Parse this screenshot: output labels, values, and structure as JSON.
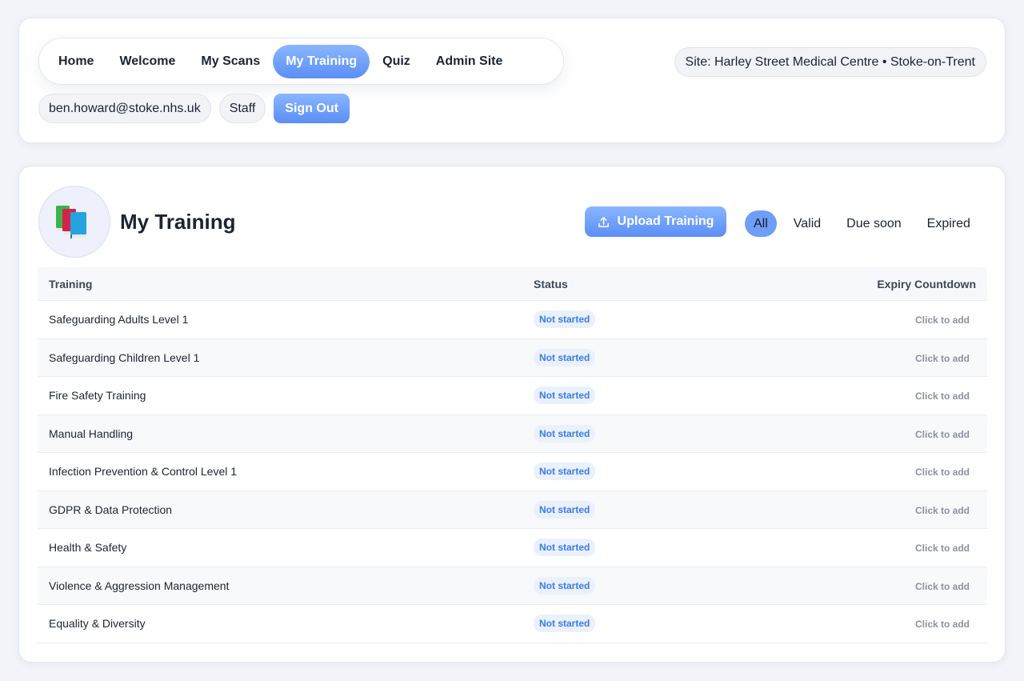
{
  "nav": {
    "items": [
      {
        "label": "Home",
        "active": false
      },
      {
        "label": "Welcome",
        "active": false
      },
      {
        "label": "My Scans",
        "active": false
      },
      {
        "label": "My Training",
        "active": true
      },
      {
        "label": "Quiz",
        "active": false
      },
      {
        "label": "Admin Site",
        "active": false
      }
    ]
  },
  "site": {
    "label": "Site: Harley Street Medical Centre • Stoke-on-Trent"
  },
  "user": {
    "email": "ben.howard@stoke.nhs.uk",
    "role": "Staff",
    "signout_label": "Sign Out"
  },
  "page": {
    "title": "My Training",
    "icon": "books-icon",
    "upload_label": "Upload Training"
  },
  "filters": [
    {
      "label": "All",
      "active": true
    },
    {
      "label": "Valid",
      "active": false
    },
    {
      "label": "Due soon",
      "active": false
    },
    {
      "label": "Expired",
      "active": false
    }
  ],
  "table": {
    "headers": {
      "training": "Training",
      "status": "Status",
      "expiry": "Expiry Countdown"
    },
    "rows": [
      {
        "training": "Safeguarding Adults Level 1",
        "status": "Not started",
        "expiry": "Click to add"
      },
      {
        "training": "Safeguarding Children Level 1",
        "status": "Not started",
        "expiry": "Click to add"
      },
      {
        "training": "Fire Safety Training",
        "status": "Not started",
        "expiry": "Click to add"
      },
      {
        "training": "Manual Handling",
        "status": "Not started",
        "expiry": "Click to add"
      },
      {
        "training": "Infection Prevention & Control Level 1",
        "status": "Not started",
        "expiry": "Click to add"
      },
      {
        "training": "GDPR & Data Protection",
        "status": "Not started",
        "expiry": "Click to add"
      },
      {
        "training": "Health & Safety",
        "status": "Not started",
        "expiry": "Click to add"
      },
      {
        "training": "Violence & Aggression Management",
        "status": "Not started",
        "expiry": "Click to add"
      },
      {
        "training": "Equality & Diversity",
        "status": "Not started",
        "expiry": "Click to add"
      }
    ]
  },
  "colors": {
    "accent": "#5b8ef6",
    "badge_text": "#3a7bea",
    "badge_bg": "#eaf1fd"
  }
}
